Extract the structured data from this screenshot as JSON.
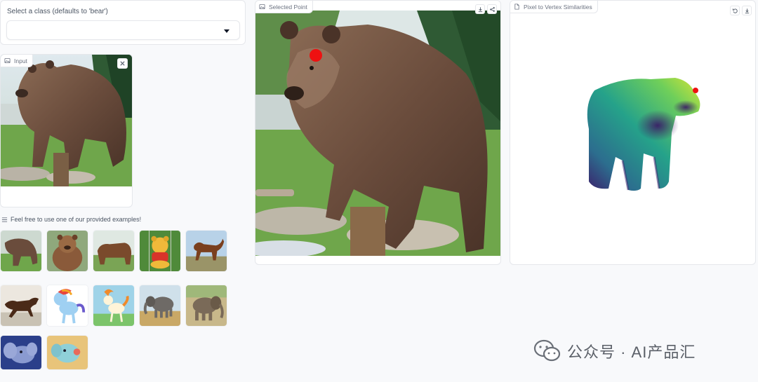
{
  "class_selector": {
    "label": "Select a class (defaults to 'bear')",
    "value": ""
  },
  "input_block": {
    "label": "Input",
    "icons": [
      "image-icon",
      "close-icon",
      "upload-icon",
      "webcam-icon",
      "clipboard-icon"
    ]
  },
  "examples": {
    "header": "Feel free to use one of our provided examples!",
    "items": [
      "bear-example-1",
      "bear-example-2",
      "bear-example-3",
      "winnie-the-pooh-example",
      "horse-example-1",
      "horse-example-2",
      "pony-example",
      "ponyta-example",
      "elephant-example-1",
      "elephant-example-2",
      "dumbo-example",
      "elephant-toy-example"
    ]
  },
  "selected_point": {
    "label": "Selected Point",
    "marker_color": "#ee1111",
    "icons": [
      "download-icon",
      "share-icon"
    ]
  },
  "similarities": {
    "label": "Pixel to Vertex Similarities",
    "icons": [
      "undo-icon",
      "download-icon"
    ]
  },
  "watermark": {
    "text": "公众号 · AI产品汇"
  },
  "colors": {
    "background": "#f8f9fb",
    "panel_border": "#e5e7eb",
    "accent_upload": "#f97316"
  }
}
